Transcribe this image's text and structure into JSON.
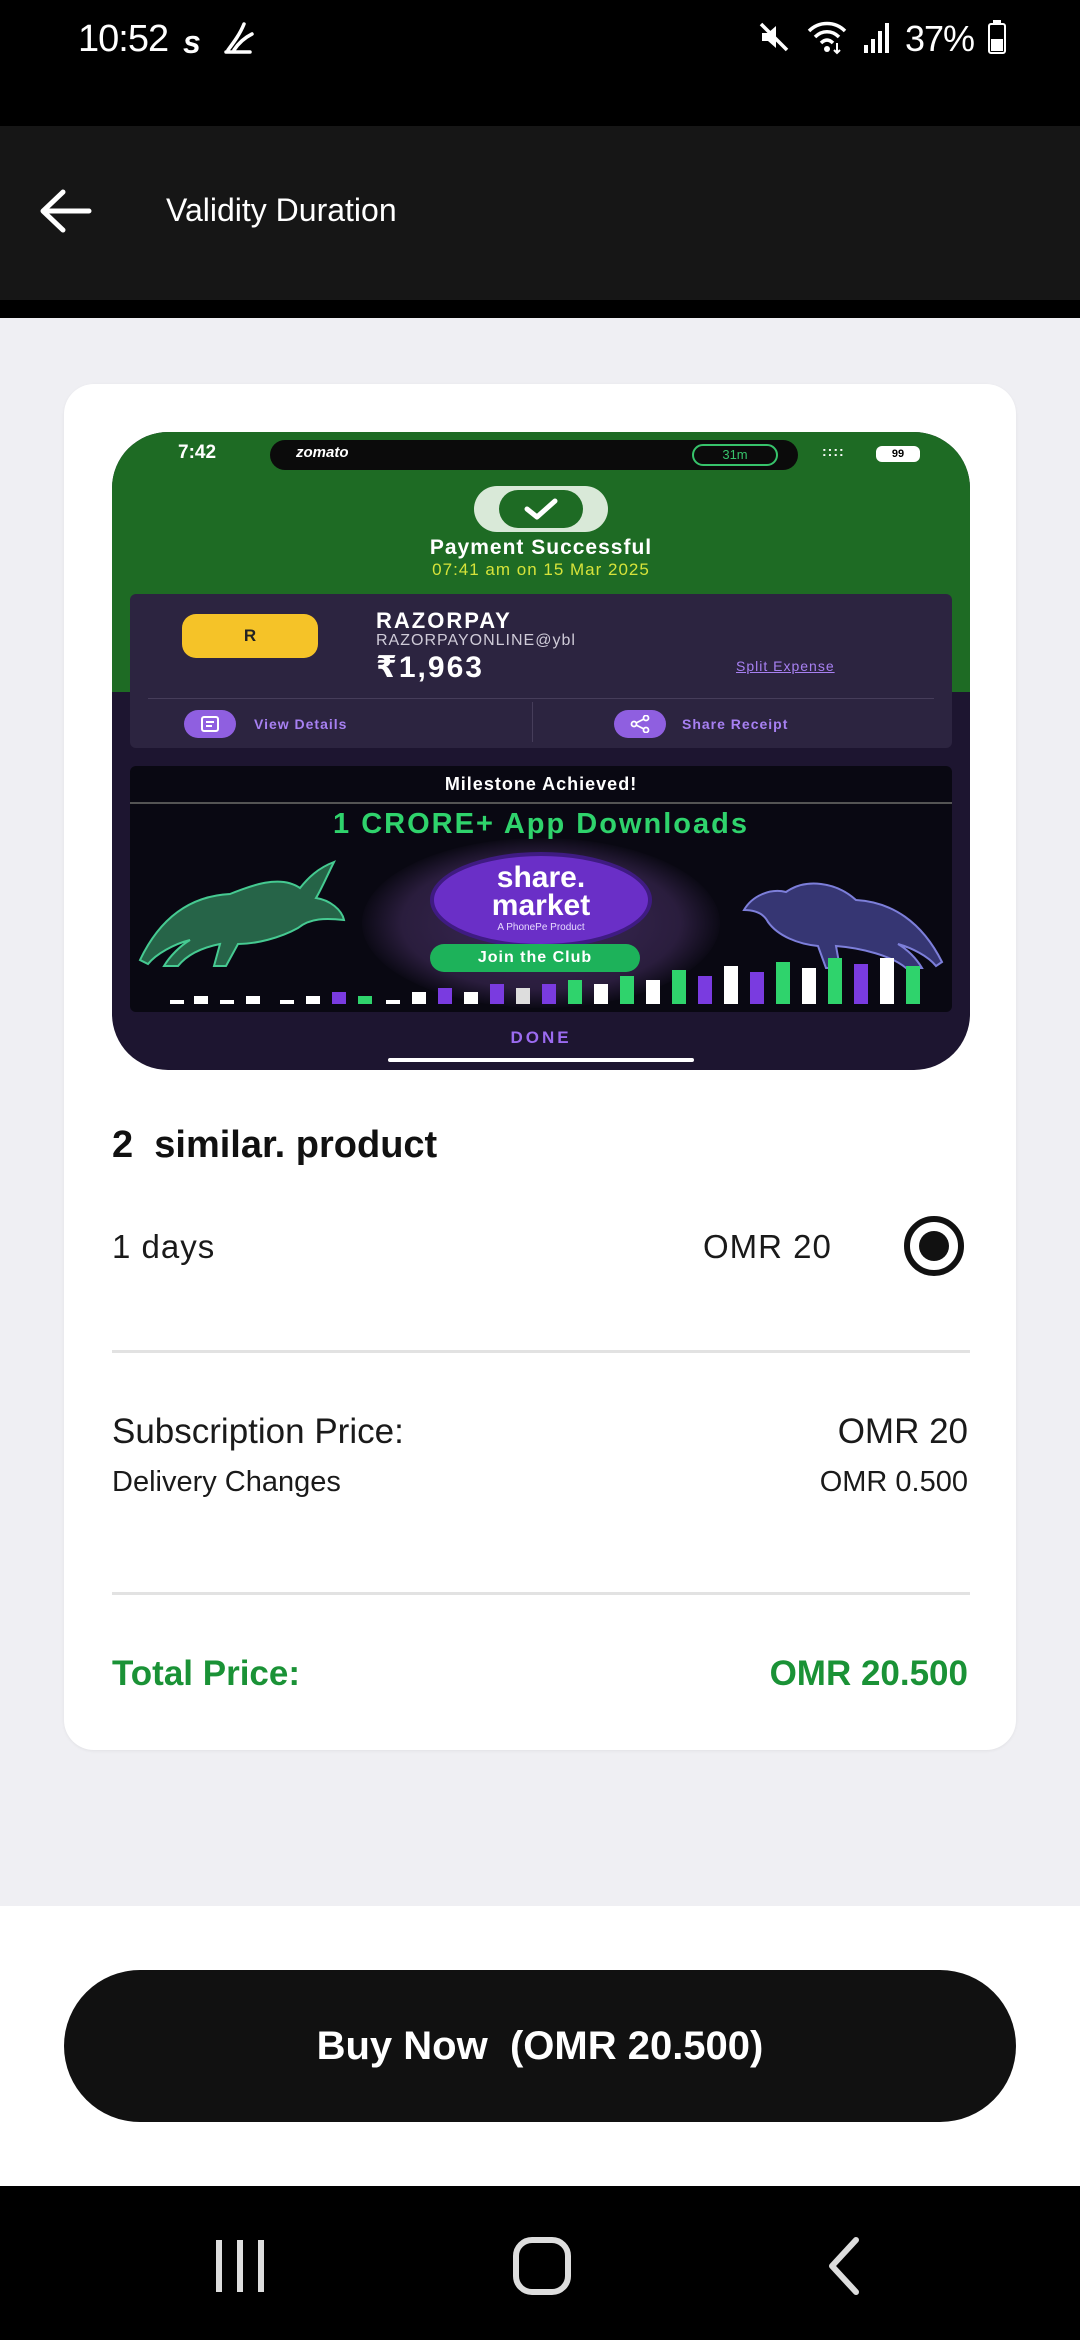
{
  "status_bar": {
    "time": "10:52",
    "app_letter": "s",
    "battery": "37%"
  },
  "app_bar": {
    "title": "Validity Duration"
  },
  "product_image": {
    "time": "7:42",
    "brand": "zomato",
    "timer": "31m",
    "battery": "99",
    "status_title": "Payment Successful",
    "status_date": "07:41 am on 15 Mar 2025",
    "avatar_initial": "R",
    "merchant": "RAZORPAY",
    "vpa": "RAZORPAYONLINE@ybl",
    "amount": "₹1,963",
    "split_link": "Split Expense",
    "view_details": "View Details",
    "share_receipt": "Share Receipt",
    "milestone": "Milestone Achieved!",
    "headline": "1 CRORE+ App Downloads",
    "logo_line1": "share.",
    "logo_line2": "market",
    "logo_sub": "A PhonePe Product",
    "join_button": "Join the Club",
    "done_button": "DONE"
  },
  "product": {
    "title": "2  similar. product"
  },
  "plan": {
    "days": "1 days",
    "price": "OMR 20",
    "selected": true
  },
  "summary": {
    "subscription_label": "Subscription Price:",
    "subscription_value": "OMR 20",
    "delivery_label": "Delivery Changes",
    "delivery_value": "OMR 0.500",
    "total_label": "Total Price:",
    "total_value": "OMR 20.500"
  },
  "actions": {
    "buy_label": "Buy Now  (OMR 20.500)"
  },
  "colors": {
    "accent_green": "#1a9236",
    "button_black": "#111111",
    "background": "#efeff3"
  }
}
